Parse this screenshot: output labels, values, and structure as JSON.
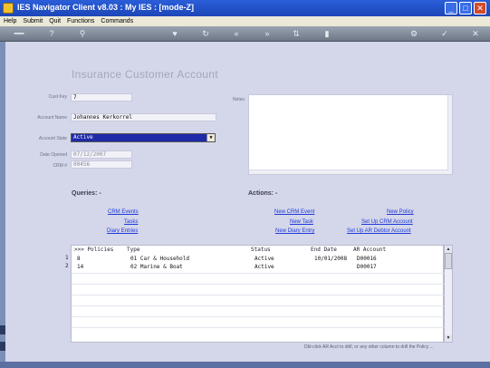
{
  "window": {
    "title": "IES Navigator Client v8.03 : My IES :       [mode-Z]"
  },
  "menu": [
    "Help",
    "Submit",
    "Quit",
    "Functions",
    "Commands"
  ],
  "toolbar_icons": [
    "back-icon",
    "help-icon",
    "search-icon",
    "favorite-icon",
    "refresh-icon",
    "prev-icon",
    "next-icon",
    "sort-icon",
    "list-icon",
    "settings-icon",
    "ok-icon",
    "close-icon"
  ],
  "form": {
    "heading": "Insurance Customer Account",
    "cust_key": {
      "label": "Cust Key",
      "value": "7"
    },
    "account_name": {
      "label": "Account Name",
      "value": "Johannes Kerkorrel"
    },
    "account_state": {
      "label": "Account State",
      "value": "Active"
    },
    "date_opened": {
      "label": "Date Opened",
      "value": "07/12/2007"
    },
    "crm_no": {
      "label": "CRM #",
      "value": "00456"
    },
    "notes": {
      "label": "Notes",
      "value": ""
    }
  },
  "queries": {
    "title": "Queries: -",
    "links": [
      "CRM Events",
      "Tasks",
      "Diary Entries"
    ]
  },
  "actions": {
    "title": "Actions: -",
    "left_links": [
      "New CRM Event",
      "New Task",
      "New Diary Entry"
    ],
    "right_links": [
      "New Policy",
      "Set Up CRM Account",
      "Set Up AR Debtor Account"
    ]
  },
  "table": {
    "columns": [
      ">>> Policies",
      "Type",
      "Status",
      "End Date",
      "AR Account"
    ],
    "rows": [
      {
        "n": "1",
        "policies": "8",
        "type": "01 Car & Household",
        "status": "Active",
        "end_date": "10/01/2008",
        "ar_account": "D00016"
      },
      {
        "n": "2",
        "policies": "14",
        "type": "02 Marine & Boat",
        "status": "Active",
        "end_date": "",
        "ar_account": "D00017"
      }
    ],
    "hint": "Dbl-click AR Acct to drill, or any other column  to drill the Policy ..."
  },
  "colors": {
    "titlebar": "#1d46b8",
    "form_bg": "#d4d6ea",
    "link": "#1f3bd8",
    "select_bg": "#1f2aa8"
  }
}
